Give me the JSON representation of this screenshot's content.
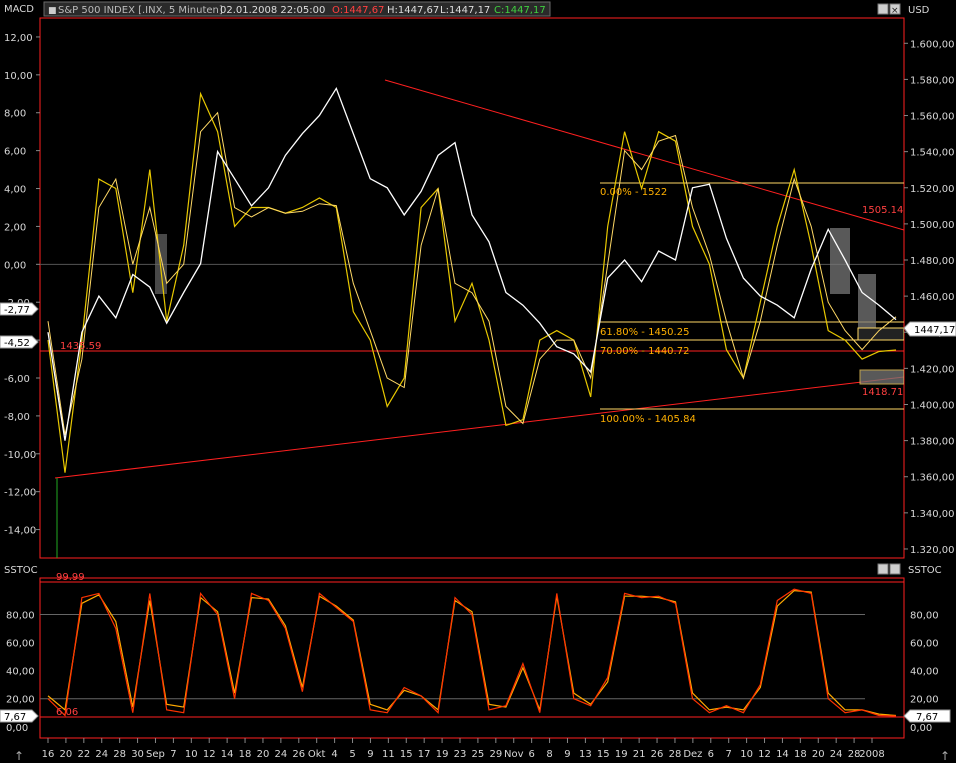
{
  "header": {
    "left_label": "MACD",
    "symbol": "S&P 500 INDEX [.INX, 5 Minuten]",
    "datetime": "02.01.2008 22:05:00",
    "open": "O:1447,67",
    "high": "H:1447,67",
    "low": "L:1447,17",
    "close": "C:1447,17",
    "right_label": "USD"
  },
  "lower_header": {
    "left_label": "SSTOC",
    "right_label": "SSTOC"
  },
  "badges": {
    "macd_1": "-2,77",
    "macd_2": "-4,52",
    "price": "1447,17",
    "sstoc_left": "7,67",
    "sstoc_right": "7,67"
  },
  "annotations": {
    "fib_0": "0.00% - 1522",
    "fib_61": "61.80% - 1450.25",
    "fib_70": "70.00% - 1440.72",
    "fib_100": "100.00% - 1405.84",
    "level_1435": "1435.59",
    "level_1505": "1505.14",
    "level_1418": "1418.71",
    "stoc_high": "99.99",
    "stoc_low": "6.06"
  },
  "colors": {
    "price": "#ffffff",
    "macd": "#e8c800",
    "signal": "#ffd966",
    "stoch_k": "#ff3300",
    "stoch_d": "#ffaa00",
    "trend": "#ff2020",
    "fib": "#ffd966",
    "background": "#000000"
  },
  "chart_data": [
    {
      "type": "line",
      "title": "S&P 500 INDEX [.INX, 5 Minuten]",
      "x_ticks": [
        "16",
        "20",
        "22",
        "24",
        "28",
        "30",
        "Sep",
        "7",
        "10",
        "12",
        "14",
        "18",
        "20",
        "24",
        "26",
        "Okt",
        "4",
        "5",
        "9",
        "11",
        "15",
        "17",
        "19",
        "23",
        "25",
        "29",
        "Nov",
        "6",
        "8",
        "9",
        "13",
        "15",
        "19",
        "21",
        "26",
        "28",
        "Dez",
        "6",
        "7",
        "10",
        "12",
        "14",
        "18",
        "20",
        "24",
        "28",
        "2008"
      ],
      "left_axis": {
        "label": "MACD",
        "ticks": [
          "12,00",
          "10,00",
          "8,00",
          "6,00",
          "4,00",
          "2,00",
          "0,00",
          "-2,00",
          "-4,00",
          "-6,00",
          "-8,00",
          "-10,00",
          "-12,00",
          "-14,00"
        ],
        "range": [
          -15.5,
          13
        ]
      },
      "right_axis": {
        "label": "USD",
        "ticks": [
          "1.600,00",
          "1.580,00",
          "1.560,00",
          "1.540,00",
          "1.520,00",
          "1.500,00",
          "1.480,00",
          "1.460,00",
          "1.440,00",
          "1.420,00",
          "1.400,00",
          "1.380,00",
          "1.360,00",
          "1.340,00",
          "1.320,00"
        ],
        "range": [
          1315,
          1614
        ]
      },
      "series": [
        {
          "name": "S&P 500",
          "axis": "right",
          "x": [
            0,
            2,
            4,
            6,
            8,
            10,
            12,
            14,
            16,
            18,
            20,
            22,
            24,
            26,
            28,
            30,
            32,
            34,
            36,
            38,
            40,
            42,
            44,
            46,
            48,
            50,
            52,
            54,
            56,
            58,
            60,
            62,
            64,
            66,
            68,
            70,
            72,
            74,
            76,
            78,
            80,
            82,
            84,
            86,
            88,
            90,
            92,
            94,
            96,
            98,
            100
          ],
          "values": [
            1440,
            1380,
            1440,
            1460,
            1448,
            1472,
            1465,
            1445,
            1462,
            1478,
            1540,
            1525,
            1510,
            1520,
            1538,
            1550,
            1560,
            1575,
            1550,
            1525,
            1520,
            1505,
            1518,
            1538,
            1545,
            1505,
            1490,
            1462,
            1455,
            1445,
            1432,
            1428,
            1418,
            1470,
            1480,
            1468,
            1485,
            1480,
            1520,
            1522,
            1492,
            1470,
            1460,
            1455,
            1448,
            1475,
            1497,
            1480,
            1462,
            1455,
            1447
          ]
        },
        {
          "name": "MACD",
          "axis": "left",
          "x": [
            0,
            2,
            4,
            6,
            8,
            10,
            12,
            14,
            16,
            18,
            20,
            22,
            24,
            26,
            28,
            30,
            32,
            34,
            36,
            38,
            40,
            42,
            44,
            46,
            48,
            50,
            52,
            54,
            56,
            58,
            60,
            62,
            64,
            66,
            68,
            70,
            72,
            74,
            76,
            78,
            80,
            82,
            84,
            86,
            88,
            90,
            92,
            94,
            96,
            98,
            100
          ],
          "values": [
            -4,
            -11,
            -4,
            4.5,
            4,
            -1.5,
            5,
            -3,
            1,
            9,
            7,
            2,
            3,
            3,
            2.7,
            3,
            3.5,
            3,
            -2.5,
            -4,
            -7.5,
            -6,
            3,
            4,
            -3,
            -1,
            -4,
            -8.5,
            -8.2,
            -4,
            -3.5,
            -4,
            -7,
            2,
            7,
            4,
            7,
            6.5,
            2,
            0,
            -4.5,
            -6,
            -2,
            2,
            5,
            1,
            -3.5,
            -4,
            -5,
            -4.6,
            -4.52
          ]
        },
        {
          "name": "Signal",
          "axis": "left",
          "x": [
            0,
            2,
            4,
            6,
            8,
            10,
            12,
            14,
            16,
            18,
            20,
            22,
            24,
            26,
            28,
            30,
            32,
            34,
            36,
            38,
            40,
            42,
            44,
            46,
            48,
            50,
            52,
            54,
            56,
            58,
            60,
            62,
            64,
            66,
            68,
            70,
            72,
            74,
            76,
            78,
            80,
            82,
            84,
            86,
            88,
            90,
            92,
            94,
            96,
            98,
            100
          ],
          "values": [
            -3,
            -9,
            -5,
            3,
            4.5,
            0,
            3,
            -1,
            0,
            7,
            8,
            3,
            2.5,
            3,
            2.7,
            2.8,
            3.2,
            3.1,
            -1,
            -3.5,
            -6,
            -6.5,
            1,
            4,
            -1,
            -1.5,
            -3,
            -7.5,
            -8.4,
            -5,
            -4,
            -4,
            -6,
            0,
            6,
            5,
            6.5,
            6.8,
            3,
            0.5,
            -3,
            -6,
            -3,
            1,
            4.5,
            2,
            -2,
            -3.5,
            -4.5,
            -3.5,
            -2.77
          ]
        }
      ]
    },
    {
      "type": "line",
      "title": "SSTOC",
      "left_axis": {
        "ticks": [
          "80,00",
          "60,00",
          "40,00",
          "20,00",
          "0,00"
        ],
        "range": [
          -8,
          106
        ]
      },
      "right_axis": {
        "ticks": [
          "80,00",
          "60,00",
          "40,00",
          "20,00",
          "0,00"
        ],
        "range": [
          -8,
          106
        ]
      },
      "series": [
        {
          "name": "%K",
          "x": [
            0,
            2,
            4,
            6,
            8,
            10,
            12,
            14,
            16,
            18,
            20,
            22,
            24,
            26,
            28,
            30,
            32,
            34,
            36,
            38,
            40,
            42,
            44,
            46,
            48,
            50,
            52,
            54,
            56,
            58,
            60,
            62,
            64,
            66,
            68,
            70,
            72,
            74,
            76,
            78,
            80,
            82,
            84,
            86,
            88,
            90,
            92,
            94,
            96,
            98,
            100
          ],
          "values": [
            20,
            8,
            92,
            95,
            70,
            10,
            95,
            12,
            10,
            95,
            80,
            20,
            95,
            90,
            70,
            25,
            95,
            85,
            75,
            12,
            10,
            28,
            22,
            10,
            92,
            80,
            12,
            15,
            45,
            10,
            95,
            20,
            15,
            35,
            95,
            92,
            93,
            88,
            20,
            10,
            15,
            10,
            30,
            90,
            98,
            95,
            20,
            10,
            12,
            8,
            7.67
          ]
        },
        {
          "name": "%D",
          "x": [
            0,
            2,
            4,
            6,
            8,
            10,
            12,
            14,
            16,
            18,
            20,
            22,
            24,
            26,
            28,
            30,
            32,
            34,
            36,
            38,
            40,
            42,
            44,
            46,
            48,
            50,
            52,
            54,
            56,
            58,
            60,
            62,
            64,
            66,
            68,
            70,
            72,
            74,
            76,
            78,
            80,
            82,
            84,
            86,
            88,
            90,
            92,
            94,
            96,
            98,
            100
          ],
          "values": [
            22,
            12,
            88,
            94,
            75,
            14,
            90,
            16,
            14,
            92,
            82,
            24,
            92,
            91,
            72,
            28,
            93,
            86,
            76,
            16,
            12,
            26,
            22,
            12,
            90,
            82,
            16,
            14,
            42,
            12,
            93,
            24,
            16,
            32,
            93,
            93,
            92,
            89,
            24,
            12,
            14,
            12,
            28,
            86,
            97,
            96,
            24,
            12,
            12,
            9,
            8
          ]
        }
      ]
    }
  ]
}
